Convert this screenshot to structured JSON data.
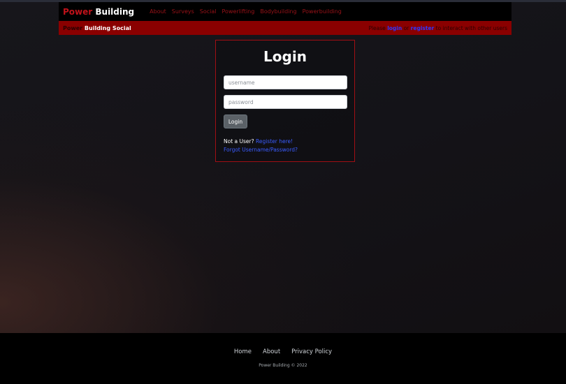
{
  "navbar": {
    "brand_red": "Power",
    "brand_white": "Building",
    "links": [
      "About",
      "Surveys",
      "Social",
      "Powerlifting",
      "Bodybuilding",
      "Powerbuilding"
    ]
  },
  "subbar": {
    "title_dim": "Power",
    "title_bright": "Building Social",
    "msg_prefix": "Please",
    "login_link": "login",
    "msg_or": "or",
    "register_link": "register",
    "msg_suffix": "to interact with other users"
  },
  "login": {
    "title": "Login",
    "username_placeholder": "username",
    "password_placeholder": "password",
    "button": "Login",
    "not_user_text": "Not a User?",
    "register_here": "Register here!",
    "forgot": "Forgot Username/Password?"
  },
  "footer": {
    "links": [
      "Home",
      "About",
      "Privacy Policy"
    ],
    "copyright": "Power Building © 2022"
  },
  "colors": {
    "brand_red": "#c1121a",
    "subbar_red": "#8a0000",
    "link_blue": "#3a5cff"
  }
}
